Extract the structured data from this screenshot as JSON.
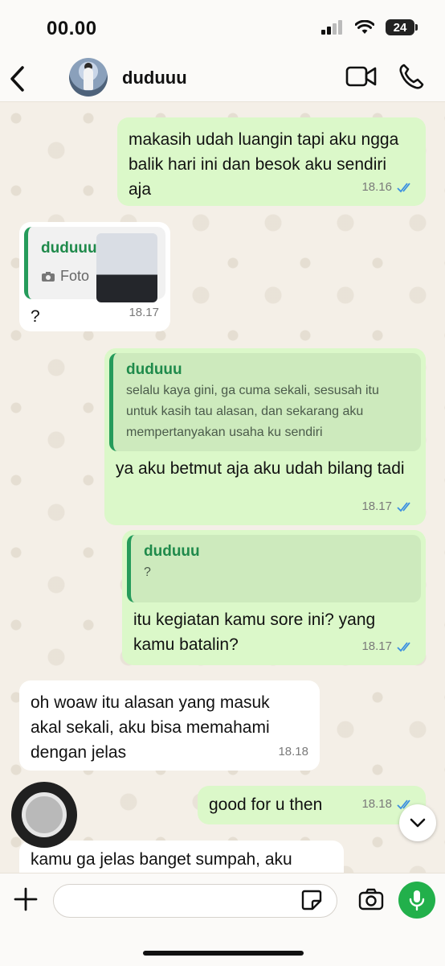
{
  "status_bar": {
    "time": "00.00",
    "battery": "24"
  },
  "header": {
    "contact_name": "duduuu"
  },
  "messages": [
    {
      "text": "makasih udah luangin tapi aku ngga balik hari ini dan besok aku sendiri aja",
      "time": "18.16"
    },
    {
      "quote_name": "duduuu",
      "quote_label": "Foto",
      "text": "?",
      "time": "18.17"
    },
    {
      "quote_name": "duduuu",
      "quote_text": "selalu kaya gini, ga cuma sekali, sesusah itu untuk kasih tau alasan, dan sekarang aku mempertanyakan usaha ku sendiri",
      "text": "ya aku betmut aja aku udah bilang tadi",
      "time": "18.17"
    },
    {
      "quote_name": "duduuu",
      "quote_text": "?",
      "text": "itu kegiatan kamu sore ini? yang kamu batalin?",
      "time": "18.17"
    },
    {
      "text": "oh woaw itu alasan yang masuk akal sekali, aku bisa memahami dengan jelas",
      "time": "18.18"
    },
    {
      "text": "good for u then",
      "time": "18.18"
    },
    {
      "text": "kamu ga jelas banget sumpah, aku"
    }
  ],
  "colors": {
    "outgoing": "#dbf8c9",
    "incoming": "#ffffff",
    "accent": "#22b04b",
    "read_ticks": "#3b8fe0"
  },
  "icons": [
    "back-chevron-icon",
    "video-call-icon",
    "phone-icon",
    "camera-icon",
    "double-check-icon",
    "plus-icon",
    "sticker-icon",
    "microphone-icon",
    "chevron-down-icon"
  ]
}
